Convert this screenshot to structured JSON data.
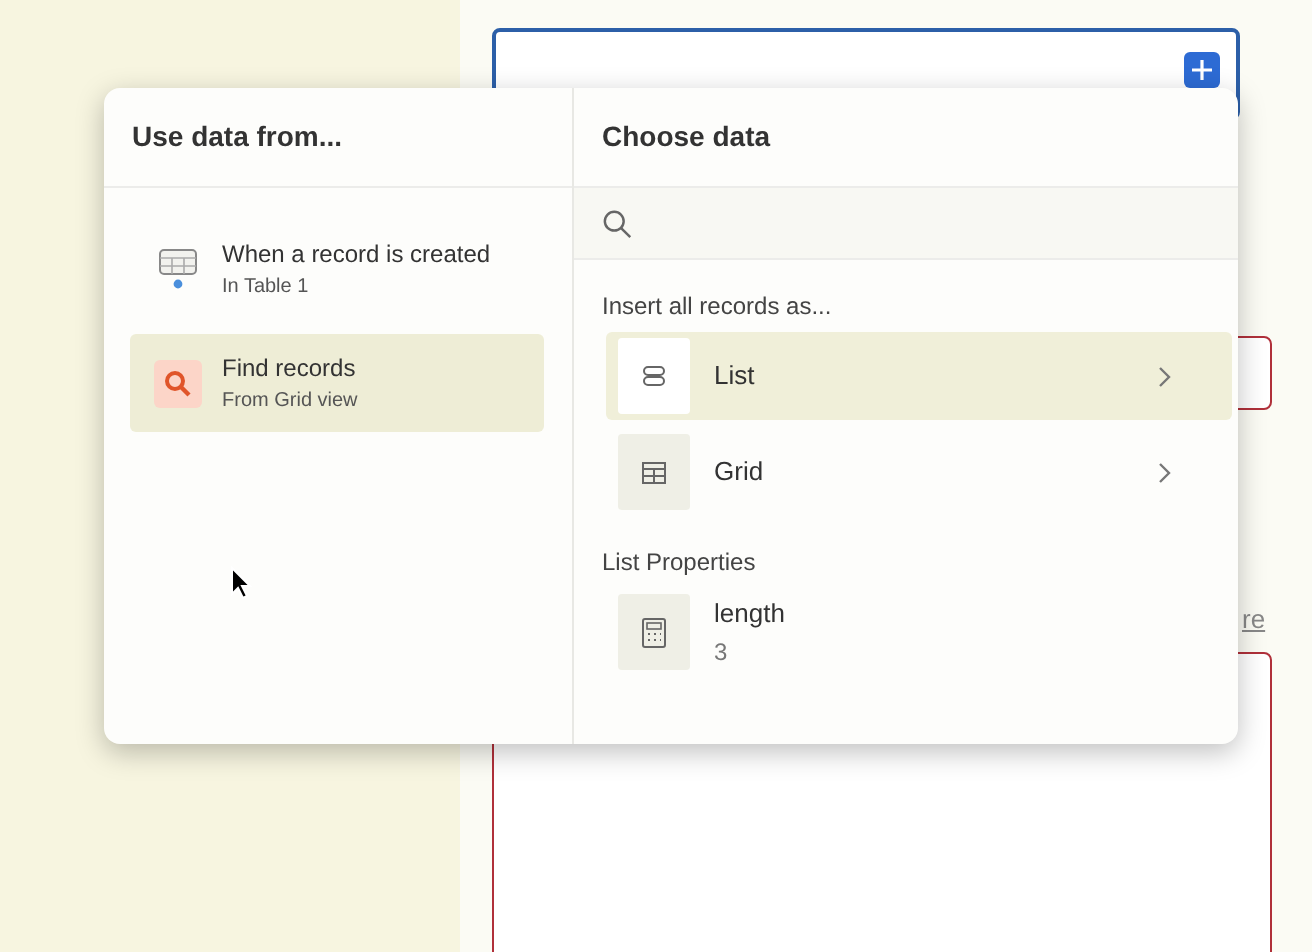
{
  "background": {
    "link": "re"
  },
  "popup": {
    "left": {
      "title": "Use data from...",
      "items": [
        {
          "title": "When a record is created",
          "subtitle": "In Table 1",
          "kind": "trigger",
          "selected": false
        },
        {
          "title": "Find records",
          "subtitle": "From Grid view",
          "kind": "find",
          "selected": true
        }
      ]
    },
    "right": {
      "title": "Choose data",
      "sections": [
        {
          "heading": "Insert all records as...",
          "items": [
            {
              "label": "List",
              "kind": "list",
              "selected": true,
              "expandable": true
            },
            {
              "label": "Grid",
              "kind": "grid",
              "selected": false,
              "expandable": true
            }
          ]
        },
        {
          "heading": "List Properties",
          "items": [
            {
              "label": "length",
              "value": "3",
              "kind": "calc",
              "selected": false,
              "expandable": false
            }
          ]
        }
      ]
    }
  }
}
